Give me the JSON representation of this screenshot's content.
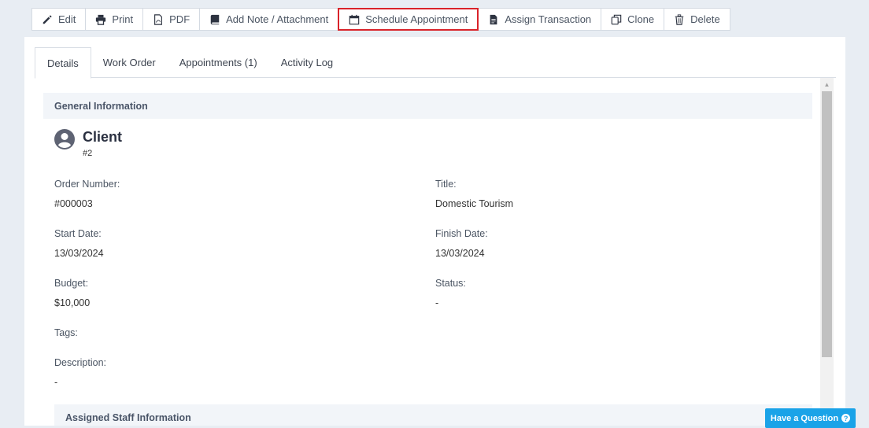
{
  "toolbar": {
    "buttons": [
      {
        "label": "Edit",
        "icon": "pencil-icon"
      },
      {
        "label": "Print",
        "icon": "printer-icon"
      },
      {
        "label": "PDF",
        "icon": "pdf-icon"
      },
      {
        "label": "Add Note / Attachment",
        "icon": "book-icon"
      },
      {
        "label": "Schedule Appointment",
        "icon": "calendar-icon"
      },
      {
        "label": "Assign Transaction",
        "icon": "document-icon"
      },
      {
        "label": "Clone",
        "icon": "clone-icon"
      },
      {
        "label": "Delete",
        "icon": "trash-icon"
      }
    ],
    "highlight_color": "#d9232a"
  },
  "tabs": [
    {
      "label": "Details"
    },
    {
      "label": "Work Order"
    },
    {
      "label": "Appointments (1)"
    },
    {
      "label": "Activity Log"
    }
  ],
  "general": {
    "header": "General Information",
    "client_label": "Client",
    "client_id": "#2",
    "order_number_label": "Order Number:",
    "order_number": "#000003",
    "title_label": "Title:",
    "title": "Domestic Tourism",
    "start_date_label": "Start Date:",
    "start_date": "13/03/2024",
    "finish_date_label": "Finish Date:",
    "finish_date": "13/03/2024",
    "budget_label": "Budget:",
    "budget": "$10,000",
    "status_label": "Status:",
    "status": "-",
    "tags_label": "Tags:",
    "description_label": "Description:",
    "description": "-"
  },
  "staff": {
    "header": "Assigned Staff Information"
  },
  "help": {
    "label": "Have a Question",
    "color": "#1aa3e8"
  }
}
